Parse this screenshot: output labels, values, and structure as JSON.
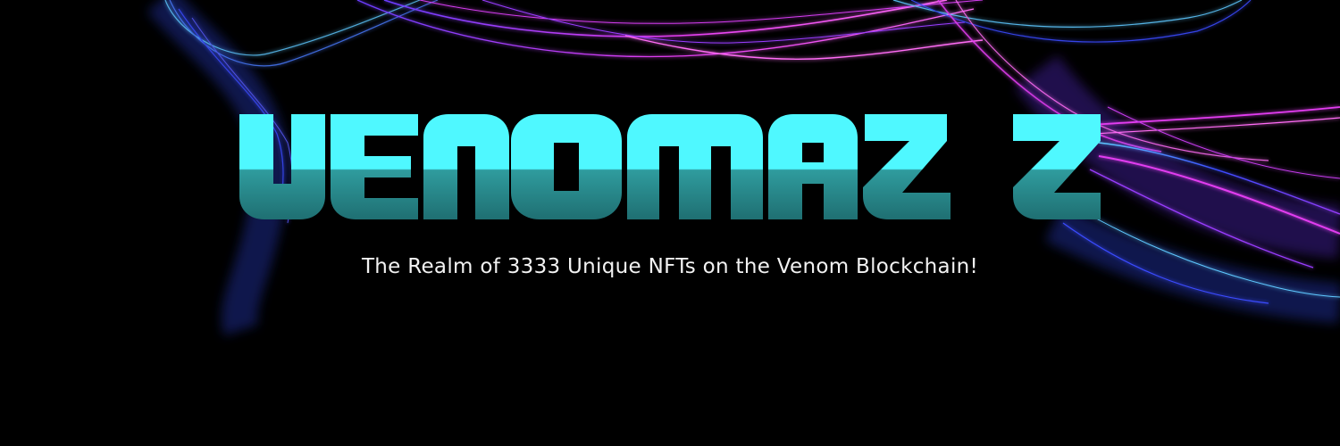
{
  "banner": {
    "title": "VENOMAZZ",
    "tagline": "The Realm of 3333 Unique NFTs on the Venom Blockchain!"
  },
  "colors": {
    "background": "#000000",
    "title_top": "#4ff8ff",
    "title_bottom": "#2a8c8e",
    "wave_magenta": "#e23cf0",
    "wave_blue": "#4a5cff",
    "wave_cyan": "#5ec8ff"
  }
}
